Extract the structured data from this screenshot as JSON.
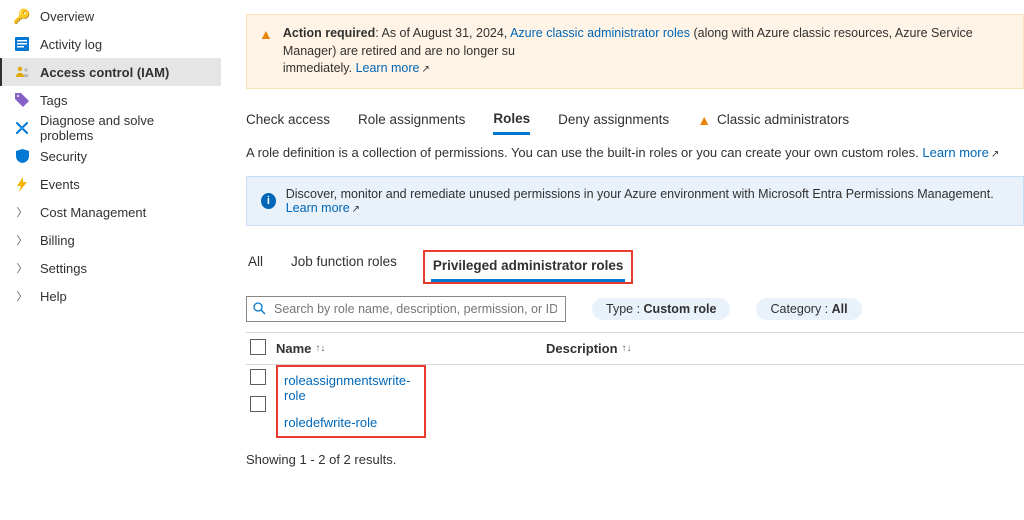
{
  "sidebar": [
    {
      "icon": "key",
      "label": "Overview"
    },
    {
      "icon": "log",
      "label": "Activity log"
    },
    {
      "icon": "iam",
      "label": "Access control (IAM)",
      "selected": true
    },
    {
      "icon": "tag",
      "label": "Tags"
    },
    {
      "icon": "diag",
      "label": "Diagnose and solve problems"
    },
    {
      "icon": "shield",
      "label": "Security"
    },
    {
      "icon": "bolt",
      "label": "Events"
    },
    {
      "icon": "chev",
      "label": "Cost Management"
    },
    {
      "icon": "chev",
      "label": "Billing"
    },
    {
      "icon": "chev",
      "label": "Settings"
    },
    {
      "icon": "chev",
      "label": "Help"
    }
  ],
  "alert": {
    "lead": "Action required",
    "mid1": ": As of August 31, 2024, ",
    "link1": "Azure classic administrator roles",
    "mid2": " (along with Azure classic resources, Azure Service Manager) are retired and are no longer su",
    "tail": "immediately. ",
    "link2": "Learn more"
  },
  "tabs": [
    "Check access",
    "Role assignments",
    "Roles",
    "Deny assignments",
    "Classic administrators"
  ],
  "description": {
    "text": "A role definition is a collection of permissions. You can use the built-in roles or you can create your own custom roles. ",
    "link": "Learn more"
  },
  "info": {
    "text": "Discover, monitor and remediate unused permissions in your Azure environment with Microsoft Entra Permissions Management. ",
    "link": "Learn more"
  },
  "subtabs": [
    "All",
    "Job function roles",
    "Privileged administrator roles"
  ],
  "search": {
    "placeholder": "Search by role name, description, permission, or ID"
  },
  "filters": {
    "type": {
      "label": "Type : ",
      "value": "Custom role"
    },
    "category": {
      "label": "Category : ",
      "value": "All"
    }
  },
  "table": {
    "cols": {
      "name": "Name",
      "desc": "Description"
    },
    "rows": [
      {
        "name": "roleassignmentswrite-role"
      },
      {
        "name": "roledefwrite-role"
      }
    ]
  },
  "results": "Showing 1 - 2 of 2 results."
}
